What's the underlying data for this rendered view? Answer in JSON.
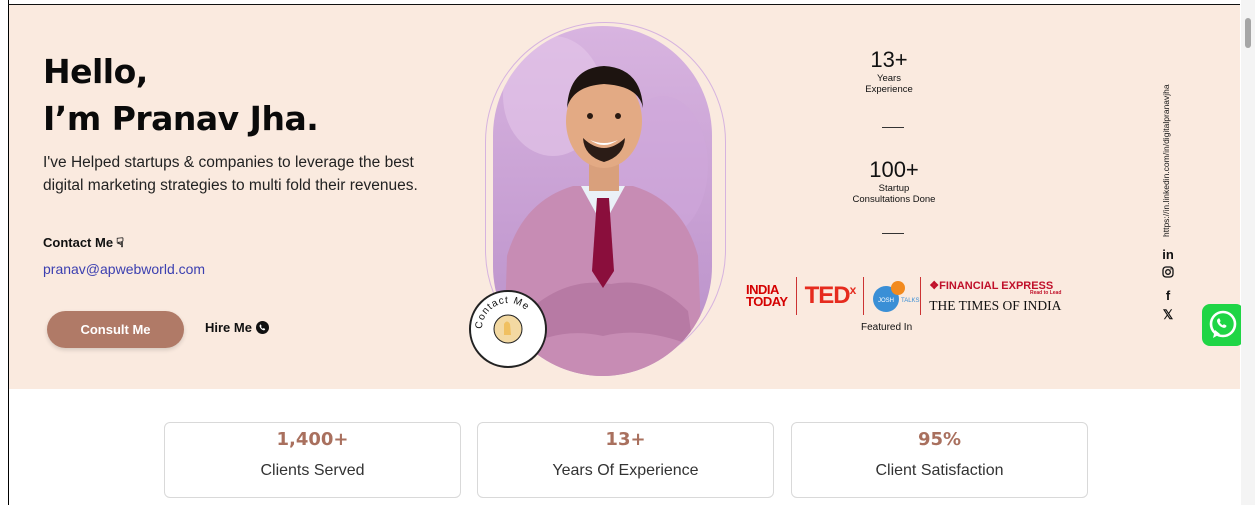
{
  "hero": {
    "greeting_line1": "Hello,",
    "greeting_line2": "I’m Pranav Jha.",
    "intro": "I've Helped startups & companies to leverage the best digital marketing strategies to multi fold their revenues.",
    "contact_label": "Contact Me",
    "email": "pranav@apwebworld.com",
    "consult_button": "Consult Me",
    "hire_label": "Hire Me",
    "badge_text": "Contact Me"
  },
  "stats_side": [
    {
      "number": "13+",
      "label1": "Years",
      "label2": "Experience"
    },
    {
      "number": "100+",
      "label1": "Startup",
      "label2": "Consultations Done"
    }
  ],
  "featured": {
    "india_today_1": "INDIA",
    "india_today_2": "TODAY",
    "tedx": "TED",
    "tedx_sup": "x",
    "josh": "JOSH TALKS",
    "financial_express": "FINANCIAL EXPRESS",
    "fe_tagline": "Read to Lead",
    "toi": "THE TIMES OF INDIA",
    "label": "Featured In"
  },
  "social": {
    "linkedin_url": "https://in.linkedin.com/in/digitalpranavjha",
    "icons": [
      "linkedin-icon",
      "instagram-icon",
      "facebook-icon",
      "x-icon"
    ]
  },
  "cards": [
    {
      "number": "1,400+",
      "label": "Clients Served"
    },
    {
      "number": "13+",
      "label": "Years Of Experience"
    },
    {
      "number": "95%",
      "label": "Client Satisfaction"
    }
  ],
  "colors": {
    "hero_bg": "#faeadf",
    "accent": "#b07a67",
    "card_number": "#a9705e",
    "email_link": "#3b3fb0",
    "whatsapp": "#1fd545"
  }
}
